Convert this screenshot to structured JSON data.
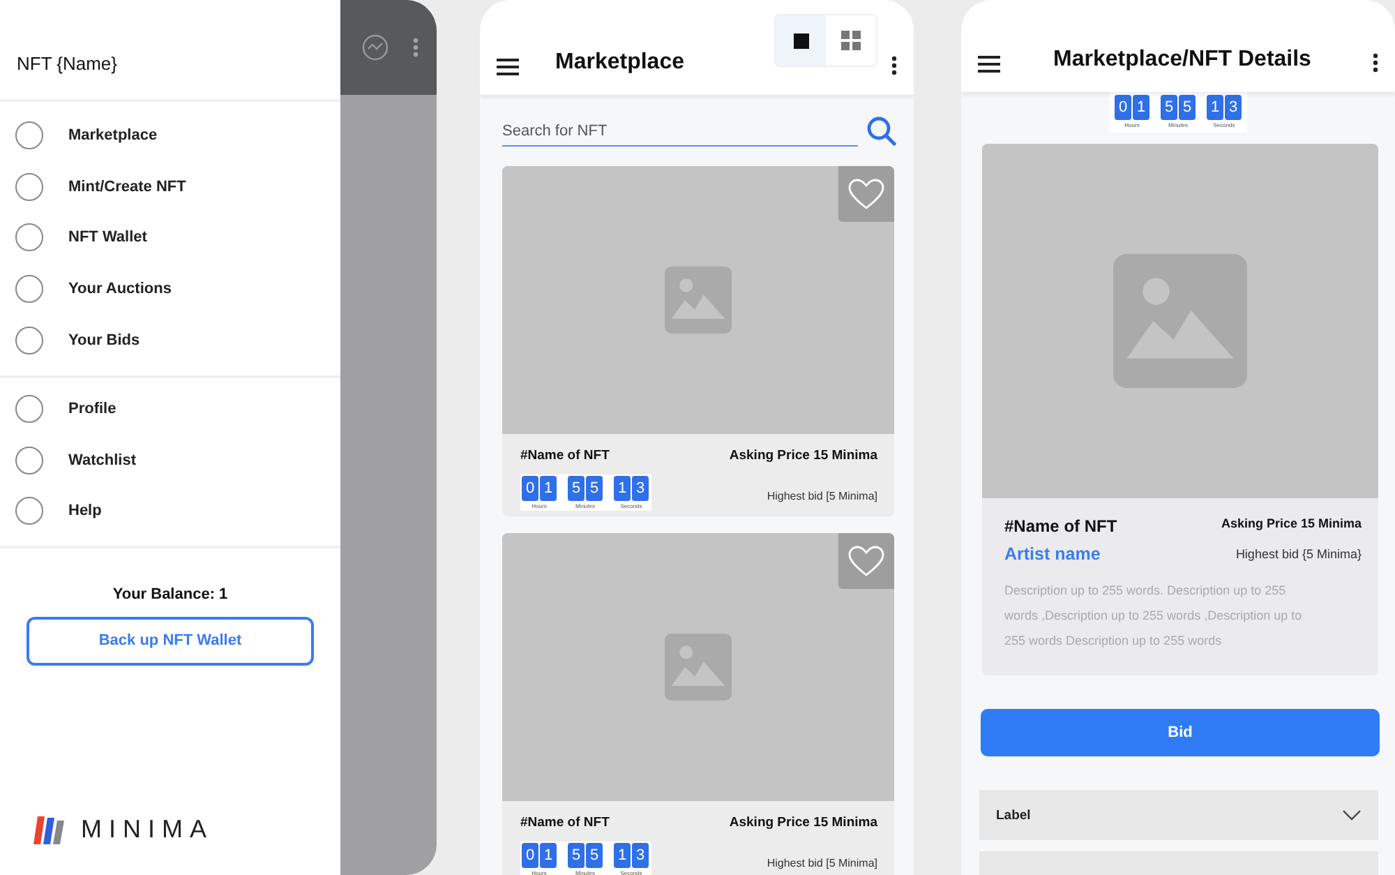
{
  "drawer": {
    "title": "NFT {Name}",
    "sections": [
      [
        {
          "label": "Marketplace",
          "selected": false
        },
        {
          "label": "Mint/Create NFT",
          "selected": false
        },
        {
          "label": "NFT Wallet",
          "selected": false
        },
        {
          "label": "Your Auctions",
          "selected": false
        },
        {
          "label": "Your Bids",
          "selected": false
        }
      ],
      [
        {
          "label": "Profile",
          "selected": false
        },
        {
          "label": "Watchlist",
          "selected": false
        },
        {
          "label": "Help",
          "selected": false
        }
      ]
    ],
    "balance": "Your Balance: 1",
    "backup_button": "Back up NFT Wallet",
    "logo_text": "MINIMA"
  },
  "marketplace": {
    "title": "Marketplace",
    "view_toggle": [
      {
        "kind": "single",
        "selected": true
      },
      {
        "kind": "grid",
        "selected": false
      }
    ],
    "search": {
      "placeholder": "Search for NFT"
    },
    "cards": [
      {
        "kind": "picture",
        "favorite": false,
        "name": "#Name of NFT",
        "price": "Asking Price 15 Minima",
        "highest_bid": "Highest bid [5 Minima]",
        "countdown": [
          {
            "digits": [
              "0",
              "1"
            ],
            "label": "Hours"
          },
          {
            "digits": [
              "5",
              "5"
            ],
            "label": "Minutes"
          },
          {
            "digits": [
              "1",
              "3"
            ],
            "label": "Seconds"
          }
        ]
      },
      {
        "kind": "picture",
        "favorite": false,
        "name": "#Name of NFT",
        "price": "Asking Price 15 Minima",
        "highest_bid": "Highest bid [5 Minima]",
        "countdown": [
          {
            "digits": [
              "0",
              "1"
            ],
            "label": "Hours"
          },
          {
            "digits": [
              "5",
              "5"
            ],
            "label": "Minutes"
          },
          {
            "digits": [
              "1",
              "3"
            ],
            "label": "Seconds"
          }
        ]
      }
    ]
  },
  "details": {
    "title": "Marketplace/NFT Details",
    "countdown": [
      {
        "digits": [
          "0",
          "1"
        ],
        "label": "Hours"
      },
      {
        "digits": [
          "5",
          "5"
        ],
        "label": "Minutes"
      },
      {
        "digits": [
          "1",
          "3"
        ],
        "label": "Seconds"
      }
    ],
    "name": "#Name of NFT",
    "price": "Asking Price 15 Minima",
    "artist": "Artist name",
    "highest_bid": "Highest bid {5 Minima}",
    "description": "Description up to 255 words. Description up to 255 words ,Description up to 255 words  ,Description up to 255 words  Description up to 255 words",
    "bid_button": "Bid",
    "accordions": [
      {
        "label": "Label",
        "expanded": false
      },
      {
        "expanded": false
      }
    ]
  }
}
